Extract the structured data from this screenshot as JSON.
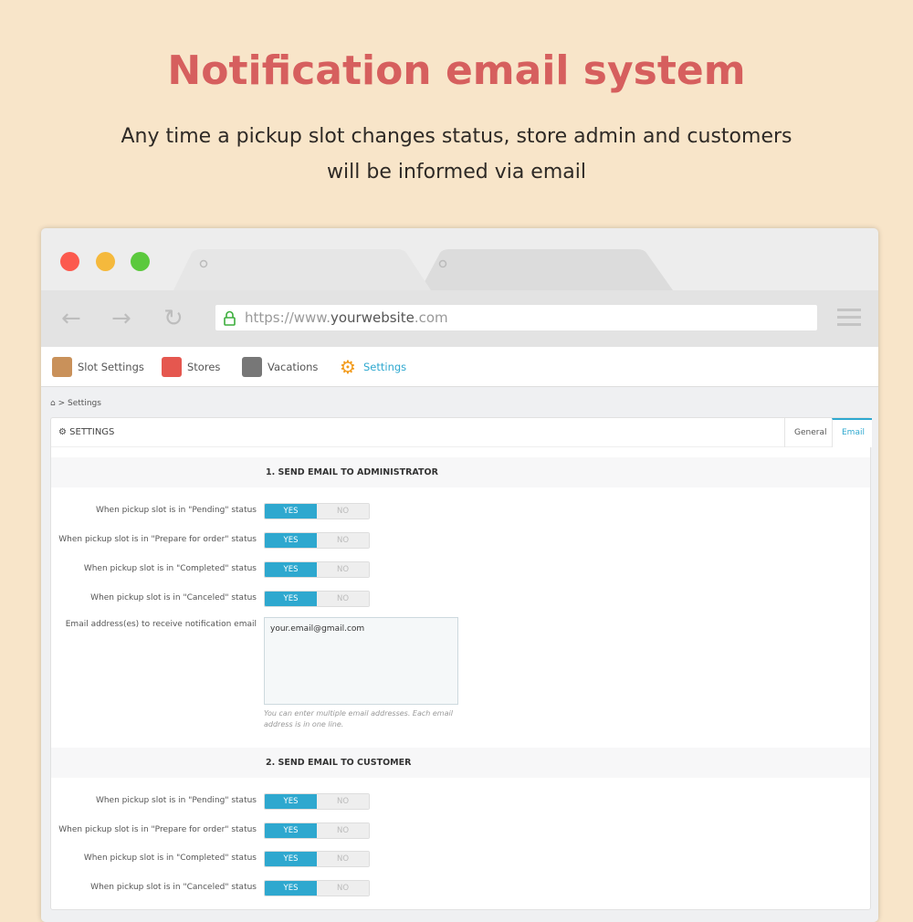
{
  "hero": {
    "title": "Notification email system",
    "line1": "Any time a pickup slot changes status, store admin and customers",
    "line2": "will be informed via email"
  },
  "browser": {
    "url_prefix": "https://www.",
    "url_domain": "yourwebsite",
    "url_suffix": ".com"
  },
  "nav": [
    {
      "label": "Slot Settings",
      "active": false
    },
    {
      "label": "Stores",
      "active": false
    },
    {
      "label": "Vacations",
      "active": false
    },
    {
      "label": "Settings",
      "active": true
    }
  ],
  "breadcrumb": {
    "sep": ">",
    "current": "Settings"
  },
  "panel": {
    "title": "SETTINGS",
    "tabs": [
      {
        "label": "General"
      },
      {
        "label": "Email",
        "active": true
      }
    ]
  },
  "toggle": {
    "yes": "YES",
    "no": "NO"
  },
  "admin": {
    "heading": "1. SEND EMAIL TO ADMINISTRATOR",
    "rows": [
      {
        "label": "When pickup slot is in \"Pending\" status",
        "value": "YES"
      },
      {
        "label": "When pickup slot is in \"Prepare for order\" status",
        "value": "YES"
      },
      {
        "label": "When pickup slot is in \"Completed\" status",
        "value": "YES"
      },
      {
        "label": "When pickup slot is in \"Canceled\" status",
        "value": "YES"
      }
    ],
    "email_label": "Email address(es) to receive notification email",
    "email_value": "your.email@gmail.com",
    "help": "You can enter multiple email addresses. Each email address is in one line."
  },
  "customer": {
    "heading": "2. SEND EMAIL TO CUSTOMER",
    "rows": [
      {
        "label": "When pickup slot is in \"Pending\" status",
        "value": "YES"
      },
      {
        "label": "When pickup slot is in \"Prepare for order\" status",
        "value": "YES"
      },
      {
        "label": "When pickup slot is in \"Completed\" status",
        "value": "YES"
      },
      {
        "label": "When pickup slot is in \"Canceled\" status",
        "value": "YES"
      }
    ]
  },
  "colors": {
    "accent": "#2ea8cf",
    "title": "#d65f5e",
    "background": "#f8e5c9"
  }
}
